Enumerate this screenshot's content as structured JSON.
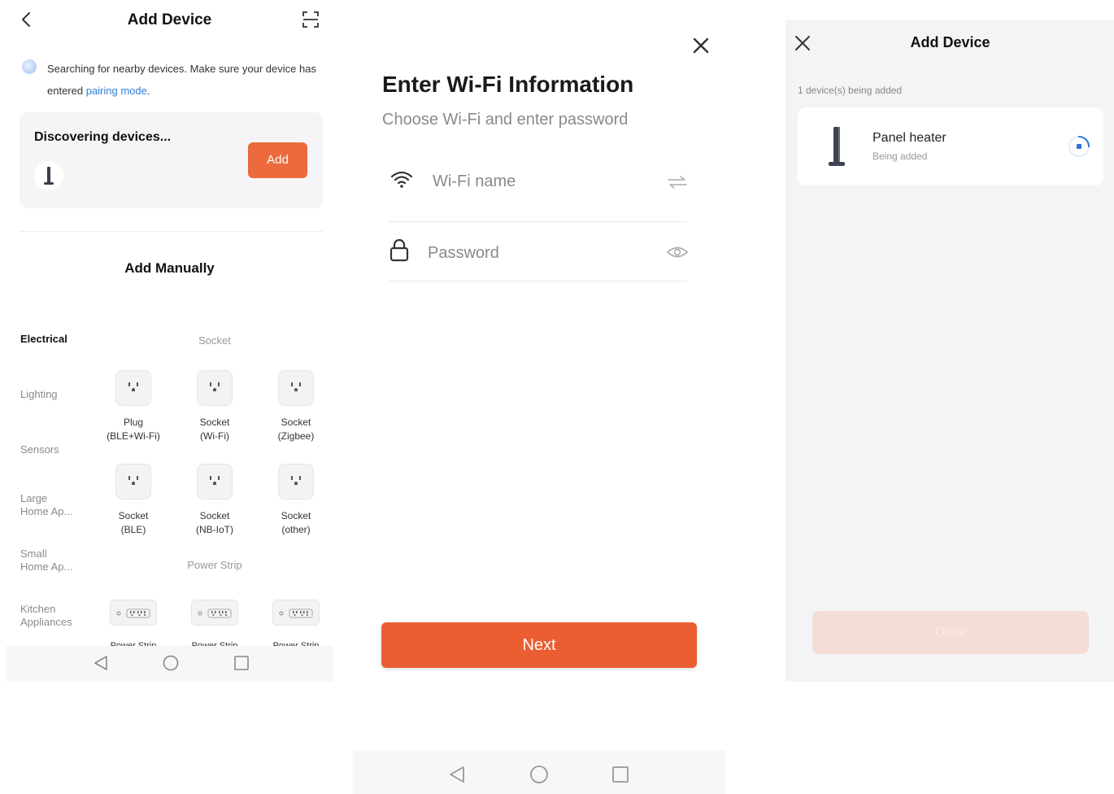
{
  "screen1": {
    "title": "Add Device",
    "search_text": "Searching for nearby devices. Make sure your device has entered ",
    "pairing_link": "pairing mode",
    "search_text_end": ".",
    "discovering": {
      "title": "Discovering devices...",
      "add_label": "Add"
    },
    "manual_title": "Add Manually",
    "categories": [
      {
        "label": "Electrical",
        "active": true
      },
      {
        "label": "Lighting"
      },
      {
        "label": "Sensors"
      },
      {
        "label": "Large\nHome Ap..."
      },
      {
        "label": "Small\nHome Ap..."
      },
      {
        "label": "Kitchen\nAppliances"
      }
    ],
    "sections": {
      "socket": "Socket",
      "power_strip": "Power Strip"
    },
    "socket_items": [
      {
        "line1": "Plug",
        "line2": "(BLE+Wi-Fi)"
      },
      {
        "line1": "Socket",
        "line2": "(Wi-Fi)"
      },
      {
        "line1": "Socket",
        "line2": "(Zigbee)"
      },
      {
        "line1": "Socket",
        "line2": "(BLE)"
      },
      {
        "line1": "Socket",
        "line2": "(NB-IoT)"
      },
      {
        "line1": "Socket",
        "line2": "(other)"
      }
    ],
    "power_strip_items": [
      {
        "label": "Power Strip"
      },
      {
        "label": "Power Strip"
      },
      {
        "label": "Power Strip"
      }
    ],
    "icons": {
      "back": "chevron-left-icon",
      "scan": "scan-icon",
      "device": "panel-heater-icon",
      "socket": "socket-icon",
      "strip": "power-strip-icon"
    },
    "colors": {
      "accent": "#ec6a3c",
      "link": "#2f7fd6"
    }
  },
  "screen2": {
    "title": "Enter Wi-Fi Information",
    "subtitle": "Choose Wi-Fi and enter password",
    "wifi_placeholder": "Wi-Fi name",
    "password_placeholder": "Password",
    "next_label": "Next",
    "icons": {
      "close": "close-icon",
      "wifi": "wifi-icon",
      "switch": "swap-icon",
      "lock": "lock-icon",
      "eye": "eye-icon"
    },
    "colors": {
      "accent": "#ea5e31"
    }
  },
  "screen3": {
    "title": "Add Device",
    "count_text": "1 device(s) being added",
    "device": {
      "name": "Panel heater",
      "status": "Being added"
    },
    "done_label": "Done",
    "icons": {
      "close": "close-icon",
      "spinner": "loading-icon"
    },
    "colors": {
      "spinner": "#2f6fe0"
    }
  }
}
